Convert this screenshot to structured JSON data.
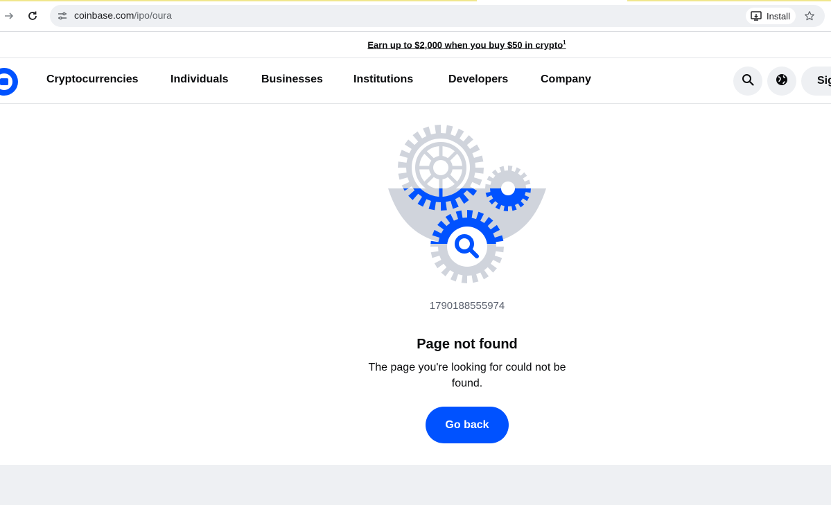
{
  "browser": {
    "url_domain": "coinbase.com",
    "url_path": "/ipo/oura",
    "install_label": "Install",
    "icons": [
      "forward-arrow-icon",
      "reload-icon",
      "site-settings-icon",
      "install-app-icon",
      "bookmark-star-icon"
    ]
  },
  "promo": {
    "text": "Earn up to $2,000 when you buy $50 in crypto",
    "footnote": "1"
  },
  "header": {
    "nav": [
      "Cryptocurrencies",
      "Individuals",
      "Businesses",
      "Institutions",
      "Developers",
      "Company"
    ],
    "signin_label": "Sign in",
    "icons": [
      "coinbase-logo",
      "search-icon",
      "globe-icon"
    ]
  },
  "error": {
    "code": "1790188555974",
    "title": "Page not found",
    "description": "The page you're looking for could not be found.",
    "button_label": "Go back"
  },
  "colors": {
    "brand_blue": "#0052ff",
    "gear_gray": "#d0d4dc",
    "surface_gray": "#eef0f3"
  }
}
